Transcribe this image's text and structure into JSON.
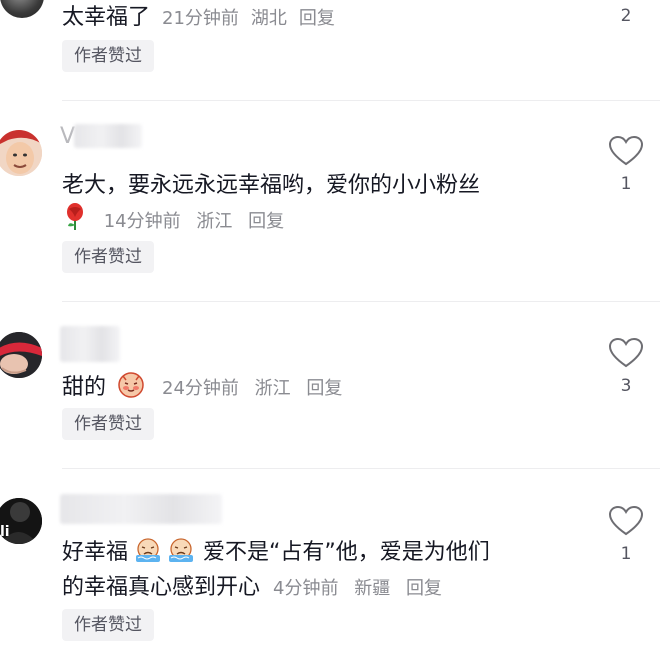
{
  "comments": [
    {
      "text": "太幸福了",
      "time": "21分钟前",
      "location": "湖北",
      "reply": "回复",
      "author_liked": "作者赞过",
      "likes": "2"
    },
    {
      "text": "老大，要永远永远幸福哟，爱你的小小粉丝",
      "time": "14分钟前",
      "location": "浙江",
      "reply": "回复",
      "author_liked": "作者赞过",
      "likes": "1",
      "name_fragment": "V",
      "emoji": "rose-emoji"
    },
    {
      "text": "甜的",
      "time": "24分钟前",
      "location": "浙江",
      "reply": "回复",
      "author_liked": "作者赞过",
      "likes": "3",
      "emoji": "shy-face-emoji"
    },
    {
      "text_line1_a": "好幸福",
      "text_line1_b": "爱不是“占有”他，爱是为他们",
      "text_line2": "的幸福真心感到开心",
      "time": "4分钟前",
      "location": "新疆",
      "reply": "回复",
      "author_liked": "作者赞过",
      "likes": "1",
      "avatar_text": "li",
      "emoji": "crying-face-emoji"
    }
  ],
  "colors": {
    "text": "#161823",
    "meta": "#8a8b91",
    "badge_bg": "#f2f2f4"
  }
}
